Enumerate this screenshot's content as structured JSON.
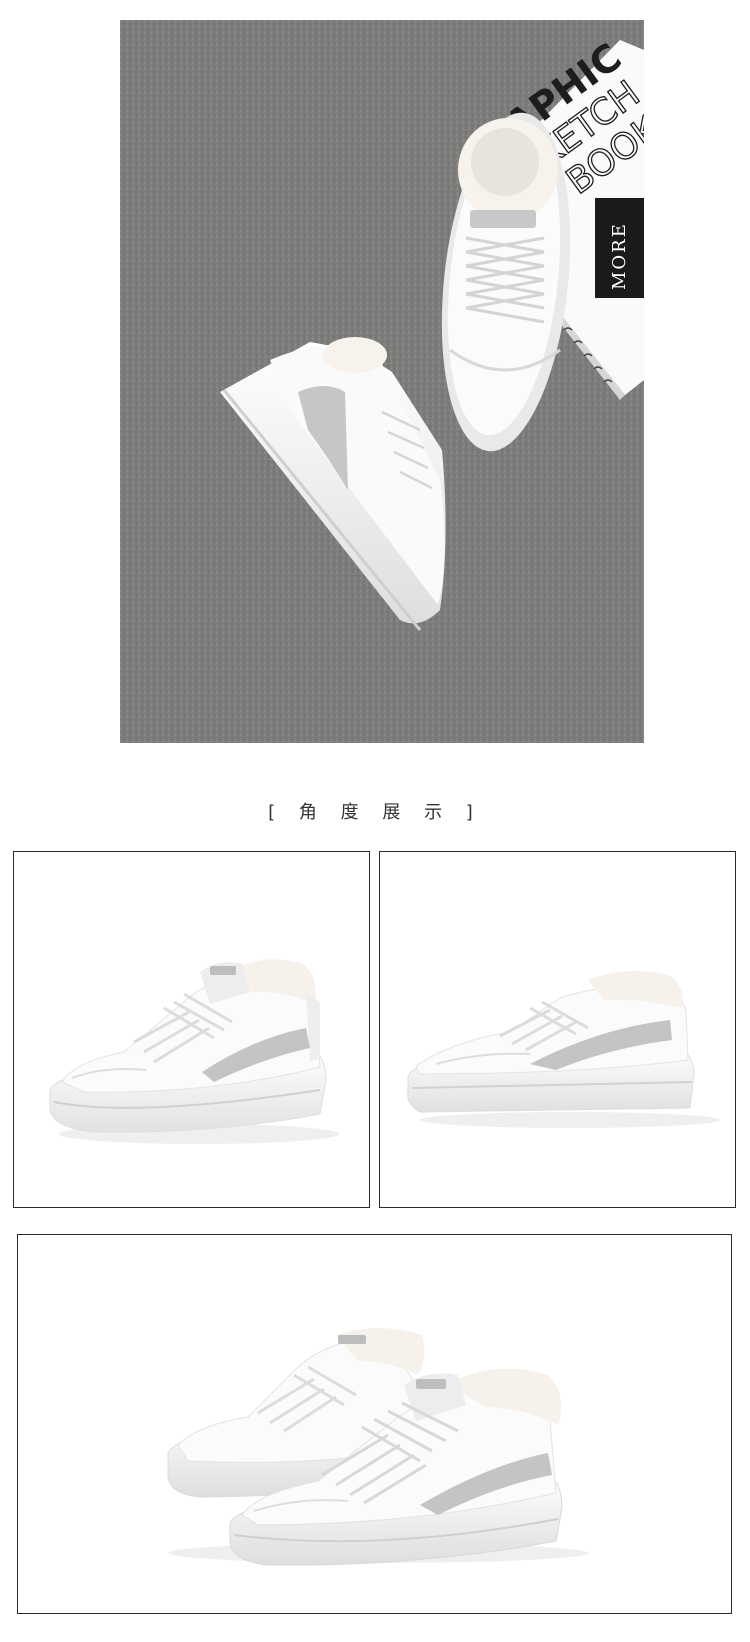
{
  "hero": {
    "book_lines": [
      "APHIC",
      "KETCH",
      "BOOK"
    ],
    "book_tag": "MORE"
  },
  "section": {
    "title": "[ 角 度 展 示 ]"
  },
  "colors": {
    "carpet": "#7d7d7b",
    "shoe_white": "#f7f7f7",
    "suede_gray": "#c4c4c4",
    "fur": "#fbf8f3",
    "frame_border": "#2a2a2a"
  }
}
